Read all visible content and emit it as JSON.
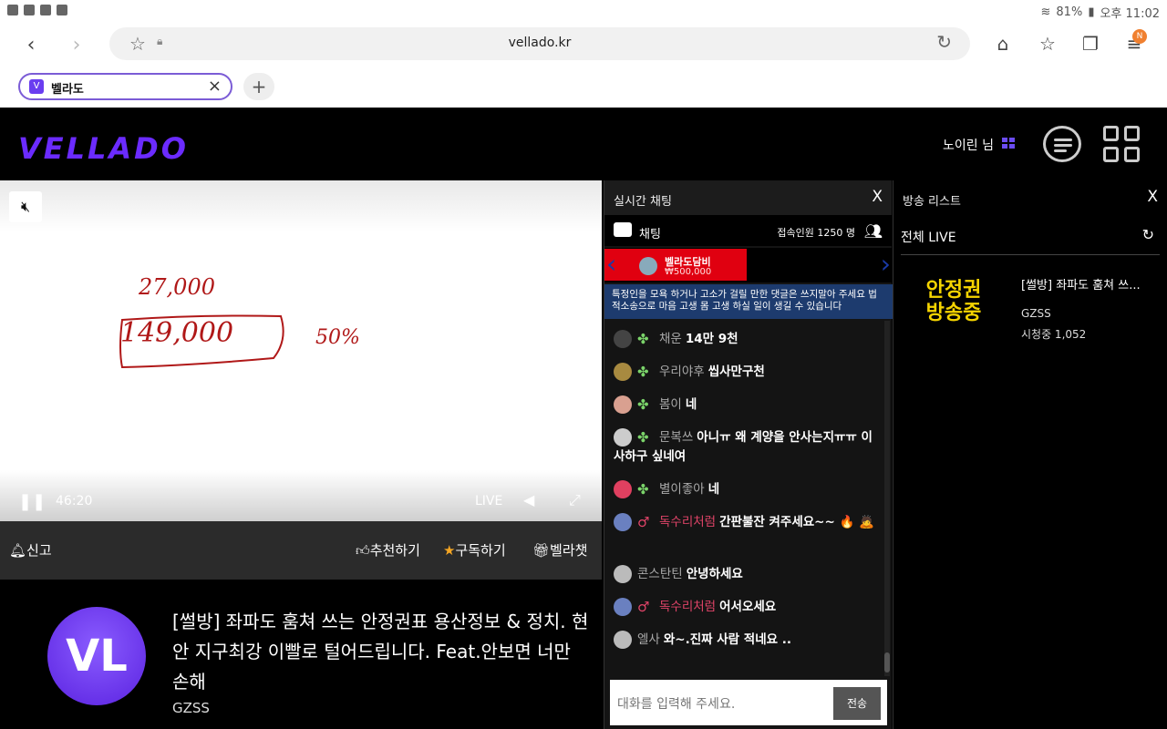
{
  "status": {
    "battery": "81%",
    "time": "오후 11:02"
  },
  "browser": {
    "url": "vellado.kr",
    "tab_title": "벨라도",
    "notification_badge": "N"
  },
  "site": {
    "logo": "VELLADO",
    "user": "노이린 님"
  },
  "video": {
    "time": "46:20",
    "live": "LIVE",
    "handwriting_lines": [
      "27,000",
      "149,000",
      "50%"
    ]
  },
  "actions": {
    "report": "신고",
    "recommend": "추천하기",
    "subscribe": "구독하기",
    "vellachat": "벨라챗"
  },
  "stream": {
    "avatar_text": "VL",
    "title": "[썰방] 좌파도 훔쳐 쓰는 안정권표 용산정보 & 정치. 현안 지구최강 이빨로 털어드립니다. Feat.안보면 너만 손해",
    "channel": "GZSS"
  },
  "chat": {
    "header": "실시간 채팅",
    "close": "X",
    "label": "채팅",
    "users": "접속인원 1250 명",
    "donor_name": "벨라도담비",
    "donor_amount": "₩500,000",
    "notice": "특정인을 모욕 하거나 고소가 걸릴 만한 댓글은 쓰지말아 주세요 법적소송으로 마음 고생 몸 고생 하실 일이 생길 수 있습니다",
    "messages": [
      {
        "nick": "채운",
        "text": "14만 9천"
      },
      {
        "nick": "우리야후",
        "text": "씹사만구천"
      },
      {
        "nick": "봄이",
        "text": "네"
      },
      {
        "nick": "문복쓰",
        "text": "아니ㅠ 왜 계양을 안사는지ㅠㅠ 이사하구 싶네여"
      },
      {
        "nick": "별이좋아",
        "text": "네"
      },
      {
        "nick": "독수리처럼",
        "text": "간판불잔 켜주세요~~ 🔥 🙇"
      },
      {
        "nick": "콘스탄틴",
        "text": "안녕하세요"
      },
      {
        "nick": "독수리처럼",
        "text": "어서오세요"
      },
      {
        "nick": "엘사",
        "text": "와~.진짜 사람 적네요 .."
      }
    ],
    "input_placeholder": "대화를 입력해 주세요.",
    "send": "전송"
  },
  "broadcast_list": {
    "header": "방송 리스트",
    "close": "X",
    "filter": "전체 LIVE",
    "items": [
      {
        "thumb_text": "안정권 방송중",
        "title": "[썰방] 좌파도 훔쳐 쓰...",
        "channel": "GZSS",
        "viewers": "시청중 1,052"
      }
    ]
  }
}
